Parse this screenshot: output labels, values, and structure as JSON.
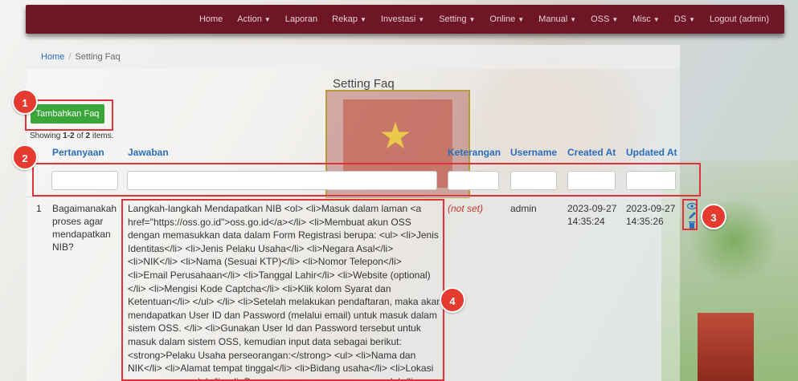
{
  "navbar": {
    "items": [
      {
        "label": "Home",
        "caret": false
      },
      {
        "label": "Action",
        "caret": true
      },
      {
        "label": "Laporan",
        "caret": false
      },
      {
        "label": "Rekap",
        "caret": true
      },
      {
        "label": "Investasi",
        "caret": true
      },
      {
        "label": "Setting",
        "caret": true
      },
      {
        "label": "Online",
        "caret": true
      },
      {
        "label": "Manual",
        "caret": true
      },
      {
        "label": "OSS",
        "caret": true
      },
      {
        "label": "Misc",
        "caret": true
      },
      {
        "label": "DS",
        "caret": true
      },
      {
        "label": "Logout (admin)",
        "caret": false
      }
    ],
    "color": "#6e1626"
  },
  "breadcrumb": {
    "home": "Home",
    "separator": "/",
    "current": "Setting Faq"
  },
  "page": {
    "title": "Setting Faq",
    "add_button": "Tambahkan Faq",
    "summary_prefix": "Showing ",
    "summary_range": "1-2",
    "summary_mid": " of ",
    "summary_total": "2",
    "summary_suffix": " items."
  },
  "table": {
    "headers": {
      "pertanyaan": "Pertanyaan",
      "jawaban": "Jawaban",
      "keterangan": "Keterangan",
      "username": "Username",
      "created_at": "Created At",
      "updated_at": "Updated At"
    },
    "rows": [
      {
        "no": "1",
        "pertanyaan": "Bagaimanakah proses agar mendapatkan NIB?",
        "jawaban": "Langkah-langkah Mendapatkan NIB <ol> <li>Masuk dalam laman <a href=\"https://oss.go.id\">oss.go.id</a></li> <li>Membuat akun OSS dengan memasukkan data dalam Form Registrasi berupa: <ul> <li>Jenis Identitas</li> <li>Jenis Pelaku Usaha</li> <li>Negara Asal</li> <li>NIK</li> <li>Nama (Sesuai KTP)</li> <li>Nomor Telepon</li> <li>Email Perusahaan</li> <li>Tanggal Lahir</li> <li>Website (optional)</li> <li>Mengisi Kode Captcha</li> <li>Klik kolom Syarat dan Ketentuan</li> </ul> </li> <li>Setelah melakukan pendaftaran, maka akan mendapatkan User ID dan Password (melalui email) untuk masuk dalam sistem OSS. </li> <li>Gunakan User Id dan Password tersebut untuk masuk dalam sistem OSS, kemudian input data sebagai berikut: <strong>Pelaku Usaha perseorangan:</strong> <ul> <li>Nama dan NIK</li> <li>Alamat tempat tinggal</li> <li>Bidang usaha</li> <li>Lokasi penanaman modal</li> <li>Besaran rencana penanaman modal</li> <li>Rencana penggunaan",
        "keterangan": "(not set)",
        "username": "admin",
        "created_date": "2023-09-27",
        "created_time": "14:35:24",
        "updated_date": "2023-09-27",
        "updated_time": "14:35:26"
      }
    ]
  },
  "actions": {
    "view_icon": "eye-icon",
    "edit_icon": "pencil-icon",
    "delete_icon": "trash-icon"
  },
  "annotations": {
    "badge1": "1",
    "badge2": "2",
    "badge3": "3",
    "badge4": "4",
    "color": "#e53a2f"
  }
}
